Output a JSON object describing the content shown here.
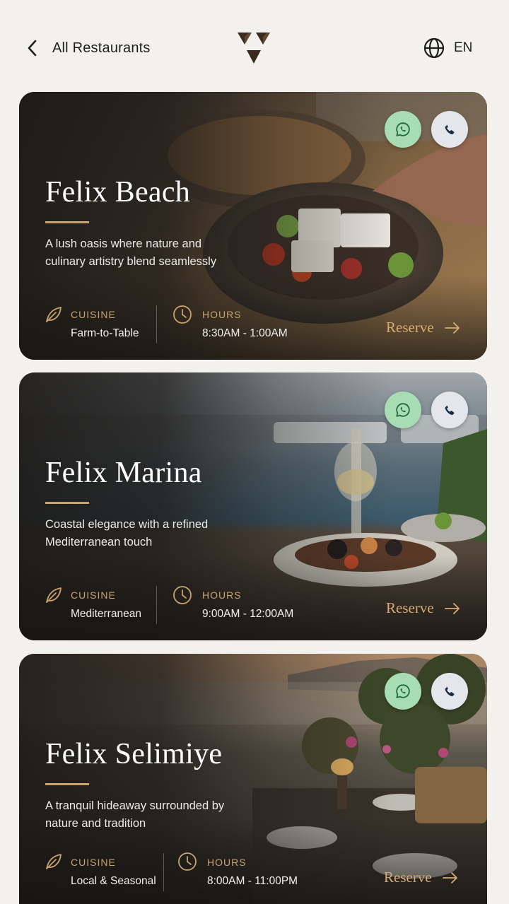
{
  "header": {
    "back_label": "All Restaurants",
    "language": "EN"
  },
  "colors": {
    "accent_gold": "#c9a36b",
    "whatsapp_bg": "#a8dcb2",
    "phone_bg": "#e4e6ec",
    "card_dark": "#1c1a18"
  },
  "labels": {
    "cuisine": "CUISINE",
    "hours": "HOURS",
    "reserve": "Reserve"
  },
  "restaurants": [
    {
      "name": "Felix Beach",
      "description": "A lush oasis where nature and culinary artistry blend seamlessly",
      "cuisine": "Farm-to-Table",
      "hours": "8:30AM - 1:00AM",
      "image": "plated-salad-photo"
    },
    {
      "name": "Felix Marina",
      "description": "Coastal elegance with a refined Mediterranean touch",
      "cuisine": "Mediterranean",
      "hours": "9:00AM - 12:00AM",
      "image": "marina-dinner-photo"
    },
    {
      "name": "Felix Selimiye",
      "description": "A tranquil hideaway surrounded by nature and tradition",
      "cuisine": "Local & Seasonal",
      "hours": "8:00AM - 11:00PM",
      "image": "garden-terrace-photo"
    }
  ]
}
